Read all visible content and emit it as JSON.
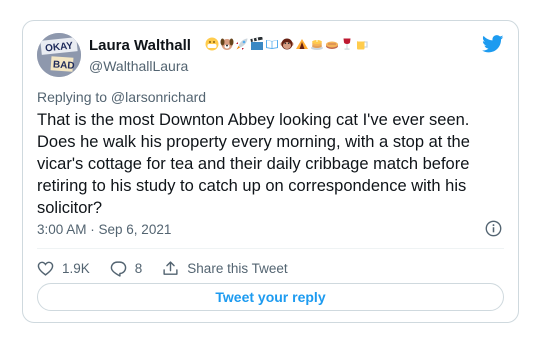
{
  "author": {
    "name": "Laura Walthall",
    "handle": "@WalthallLaura",
    "avatar_text": [
      "OKAY",
      "BAD"
    ],
    "name_emojis": [
      "grinning-mask-face",
      "dog-face",
      "rocket",
      "clapper-board",
      "open-book",
      "monkey-face",
      "tent",
      "pancakes",
      "pie",
      "wine-glass",
      "beer-mug"
    ]
  },
  "brand": {
    "icon": "twitter-bird-icon",
    "color": "#1d9bf0"
  },
  "tweet": {
    "reply_to": "Replying to @larsonrichard",
    "text": "That is the most Downton Abbey looking cat I've ever seen. Does he walk his property every morning, with a stop at the vicar's cottage for tea and their daily cribbage match before retiring to his study to catch up on correspondence with his solicitor?",
    "timestamp": "3:00 AM · Sep 6, 2021"
  },
  "actions": {
    "likes": "1.9K",
    "replies": "8",
    "share_label": "Share this Tweet"
  },
  "reply_button": {
    "label": "Tweet your reply"
  }
}
